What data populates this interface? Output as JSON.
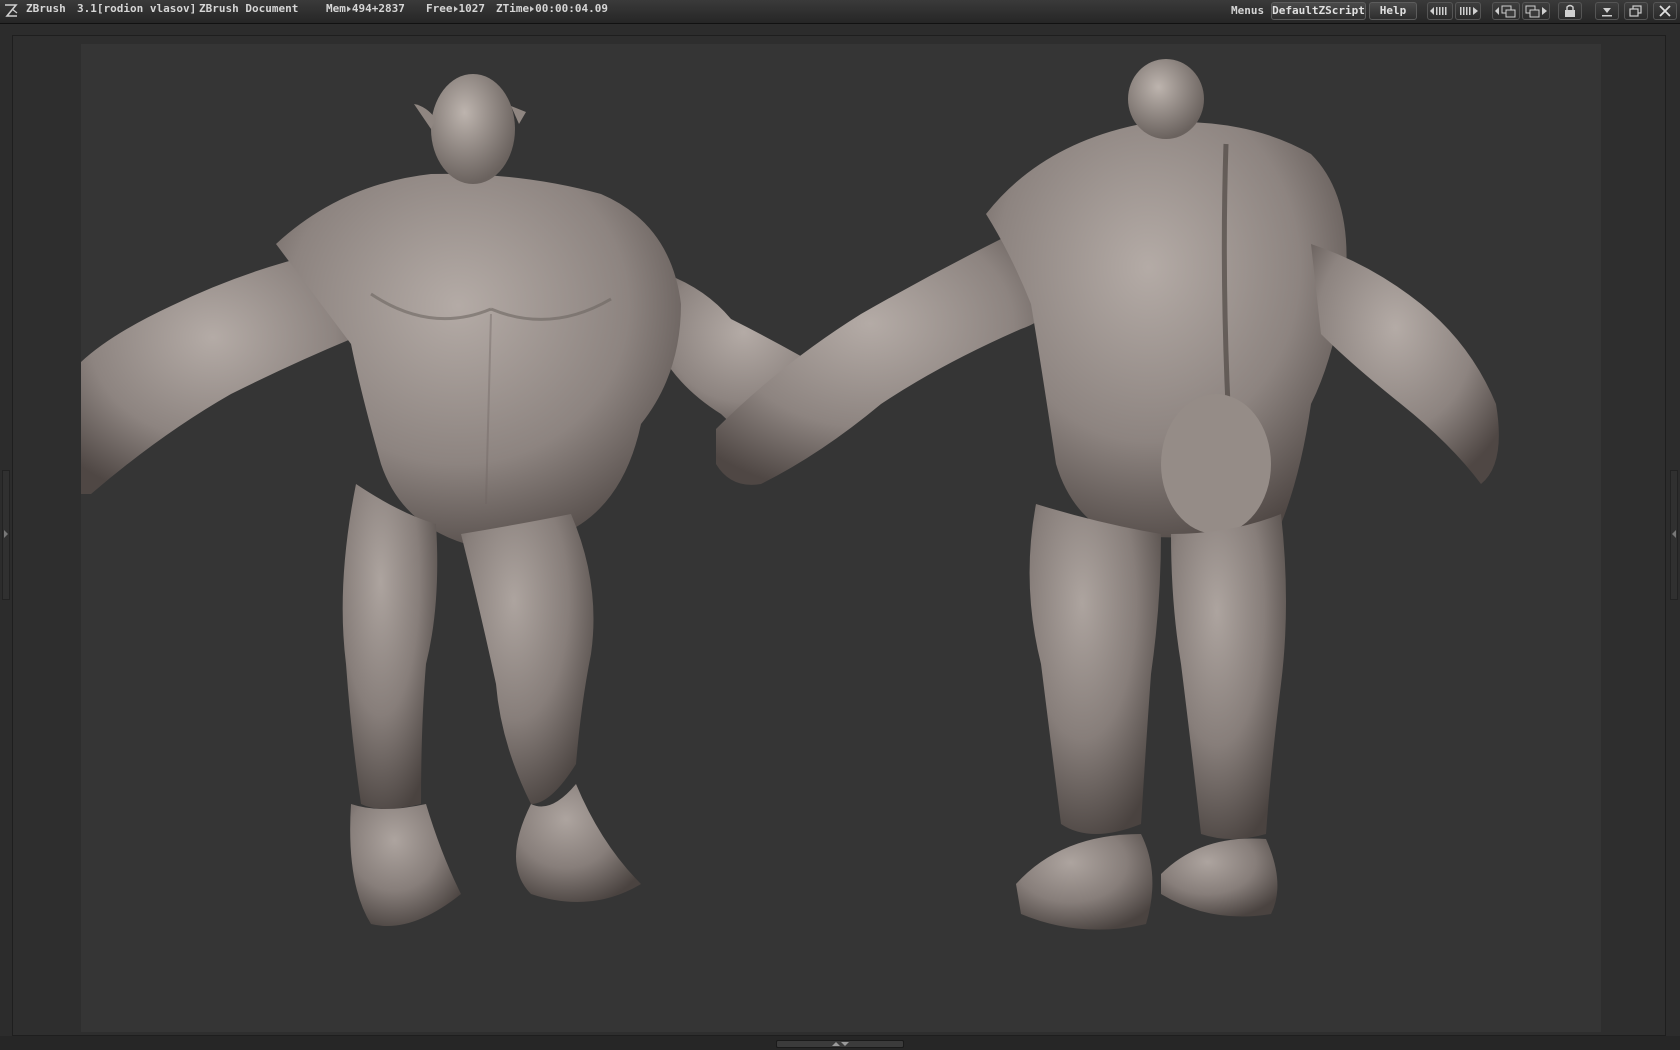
{
  "titlebar": {
    "app_name": "ZBrush",
    "version_user": "3.1[rodion vlasov]",
    "document": "ZBrush Document",
    "mem_label": "Mem",
    "mem_value": "494+2837",
    "free_label": "Free",
    "free_value": "1027",
    "ztime_label": "ZTime",
    "ztime_value": "00:00:04.09",
    "menus_label": "Menus",
    "script_label": "DefaultZScript",
    "help_label": "Help"
  },
  "icons": {
    "logo": "zbrush-logo-icon",
    "tray_left": "tray-left-icon",
    "tray_right": "tray-right-icon",
    "layout_prev": "layout-prev-icon",
    "layout_next": "layout-next-icon",
    "lock": "lock-icon",
    "minimize": "minimize-icon",
    "restore": "restore-icon",
    "close": "close-icon"
  },
  "colors": {
    "background": "#2c2c2c",
    "document": "#353535",
    "clay": "#8d8480",
    "clay_light": "#b4aba6",
    "clay_dark": "#4f4744"
  }
}
